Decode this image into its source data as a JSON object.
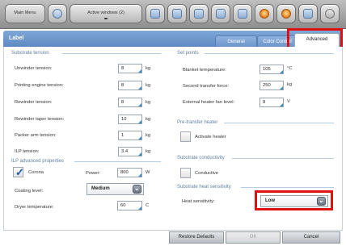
{
  "toolbar": {
    "main_menu_label": "Main Menu",
    "active_windows_label": "Active windows (2)",
    "icons": [
      "home-icon",
      "page-icon",
      "camera-icon",
      "print-icon",
      "document-icon",
      "edit-icon",
      "warning-icon",
      "settings-icon",
      "schedule-icon",
      "info-icon"
    ]
  },
  "window": {
    "title": "Label",
    "tabs": [
      "General",
      "Color Control",
      "Advanced"
    ],
    "active_tab": "Advanced"
  },
  "substrate_tension": {
    "title": "Substrate tension",
    "rows": [
      {
        "label": "Unwinder tension:",
        "value": "8",
        "unit": "kg"
      },
      {
        "label": "Printing engine tension:",
        "value": "8",
        "unit": "kg"
      },
      {
        "label": "Rewinder tension:",
        "value": "8",
        "unit": "kg"
      },
      {
        "label": "Rewinder taper tension:",
        "value": "10",
        "unit": "kg"
      },
      {
        "label": "Packer arm tension:",
        "value": "1",
        "unit": "kg"
      },
      {
        "label": "ILP tension:",
        "value": "3.4",
        "unit": "kg"
      }
    ]
  },
  "ilp_advanced": {
    "title": "ILP advanced properties",
    "corona_label": "Corona",
    "corona_checked": true,
    "power_label": "Power:",
    "power_value": "800",
    "power_unit": "W",
    "coating_label": "Coating level:",
    "coating_value": "Medium",
    "dryer_label": "Dryer temperature:",
    "dryer_value": "60",
    "dryer_unit": "C"
  },
  "set_points": {
    "title": "Set points",
    "rows": [
      {
        "label": "Blanket temperature:",
        "value": "105",
        "unit": "°C"
      },
      {
        "label": "Second transfer force:",
        "value": "250",
        "unit": "kg"
      },
      {
        "label": "External heater fan level:",
        "value": "8",
        "unit": "V"
      }
    ]
  },
  "pre_transfer": {
    "title": "Pre-transfer heater",
    "checkbox_label": "Activate heater",
    "checked": false
  },
  "conductivity": {
    "title": "Substrate conductivity",
    "checkbox_label": "Conductive",
    "checked": false
  },
  "heat_sensitivity": {
    "title": "Substrate heat sensitivity",
    "label": "Heat sensitivity:",
    "value": "Low"
  },
  "footer": {
    "restore_label": "Restore Defaults",
    "ok_label": "OK",
    "cancel_label": "Cancel"
  },
  "colors": {
    "header_blue": "#6f98cd",
    "highlight_red": "#e01010",
    "field_accent": "#3a8cc9"
  }
}
